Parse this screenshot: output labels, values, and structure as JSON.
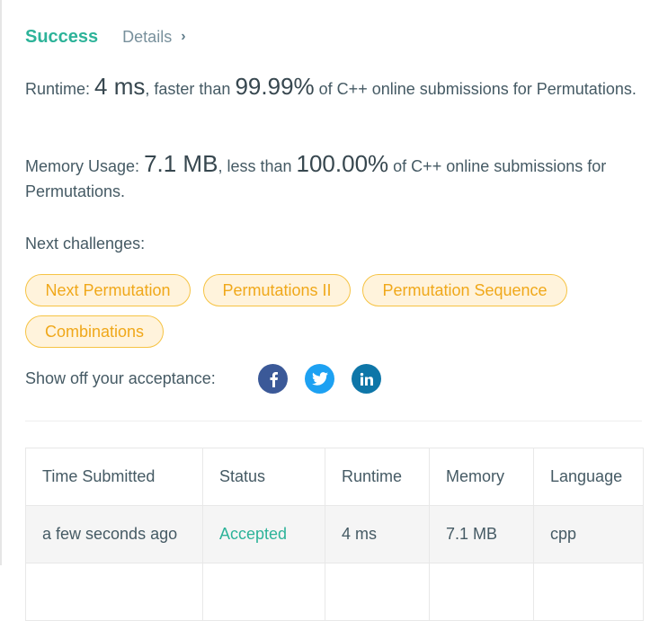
{
  "header": {
    "status": "Success",
    "details_label": "Details",
    "details_chevron": "›"
  },
  "runtime": {
    "label": "Runtime:",
    "value": "4 ms",
    "mid": ", faster than",
    "percent": "99.99%",
    "suffix": "of C++ online submissions for Permutations."
  },
  "memory": {
    "label": "Memory Usage:",
    "value": "7.1 MB",
    "mid": ", less than",
    "percent": "100.00%",
    "suffix": "of C++ online submissions for Permutations."
  },
  "next": {
    "label": "Next challenges:",
    "challenges": [
      "Next Permutation",
      "Permutations II",
      "Permutation Sequence",
      "Combinations"
    ]
  },
  "share": {
    "label": "Show off your acceptance:",
    "icons": [
      "facebook-icon",
      "twitter-icon",
      "linkedin-icon"
    ]
  },
  "table": {
    "headers": [
      "Time Submitted",
      "Status",
      "Runtime",
      "Memory",
      "Language"
    ],
    "rows": [
      [
        "a few seconds ago",
        "Accepted",
        "4 ms",
        "7.1 MB",
        "cpp"
      ]
    ]
  },
  "colors": {
    "success": "#2db399",
    "chip_text": "#f0a81a",
    "chip_bg": "#fff3dc",
    "chip_border": "#f6c343",
    "facebook": "#3b5998",
    "twitter": "#1da1f2",
    "linkedin": "#0e76a8"
  }
}
